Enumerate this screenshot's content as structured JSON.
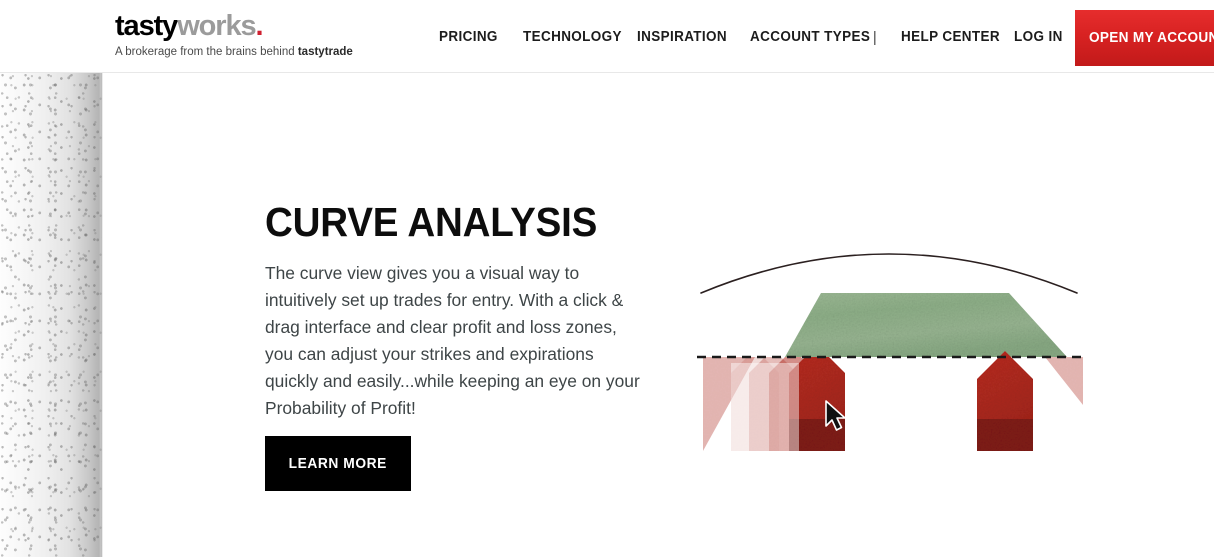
{
  "header": {
    "logo": {
      "part_one": "tasty",
      "part_two": "works",
      "dot": ".",
      "tagline_prefix": "A brokerage from the brains behind ",
      "tagline_brand": "tastytrade"
    },
    "nav": {
      "pricing": "PRICING",
      "technology": "TECHNOLOGY",
      "inspiration": "INSPIRATION",
      "account_types": "ACCOUNT TYPES",
      "divider": "|",
      "help_center": "HELP CENTER",
      "log_in": "LOG IN"
    },
    "cta": {
      "open_account": "OPEN MY ACCOUNT",
      "color": "#d82222"
    }
  },
  "main": {
    "title": "CURVE ANALYSIS",
    "body": "The curve view gives you a visual way to intuitively set up trades for entry. With a click & drag interface and clear profit and loss zones, you can adjust your strikes and expirations quickly and easily...while keeping an eye on your Probability of Profit!",
    "learn_more": "LEARN MORE"
  },
  "illustration": {
    "name": "options-payoff-curve-diagram",
    "profit_zone_color": "#8fae8a",
    "loss_zone_color": "#b22a20",
    "loss_zone_dark_color": "#7d1b16",
    "zero_line_color": "#1a1a1a",
    "probability_curve_color": "#2b2020",
    "cursor": "arrow-pointer"
  }
}
